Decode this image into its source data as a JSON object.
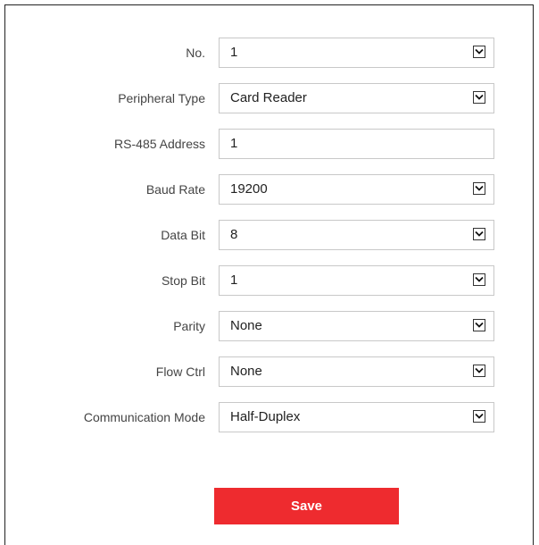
{
  "form": {
    "fields": [
      {
        "label": "No.",
        "value": "1",
        "type": "select"
      },
      {
        "label": "Peripheral Type",
        "value": "Card Reader",
        "type": "select"
      },
      {
        "label": "RS-485 Address",
        "value": "1",
        "type": "text"
      },
      {
        "label": "Baud Rate",
        "value": "19200",
        "type": "select"
      },
      {
        "label": "Data Bit",
        "value": "8",
        "type": "select"
      },
      {
        "label": "Stop Bit",
        "value": "1",
        "type": "select"
      },
      {
        "label": "Parity",
        "value": "None",
        "type": "select"
      },
      {
        "label": "Flow Ctrl",
        "value": "None",
        "type": "select"
      },
      {
        "label": "Communication Mode",
        "value": "Half-Duplex",
        "type": "select"
      }
    ]
  },
  "actions": {
    "save_label": "Save"
  },
  "colors": {
    "save_button": "#ee2b2f",
    "border": "#c8c8c8"
  }
}
